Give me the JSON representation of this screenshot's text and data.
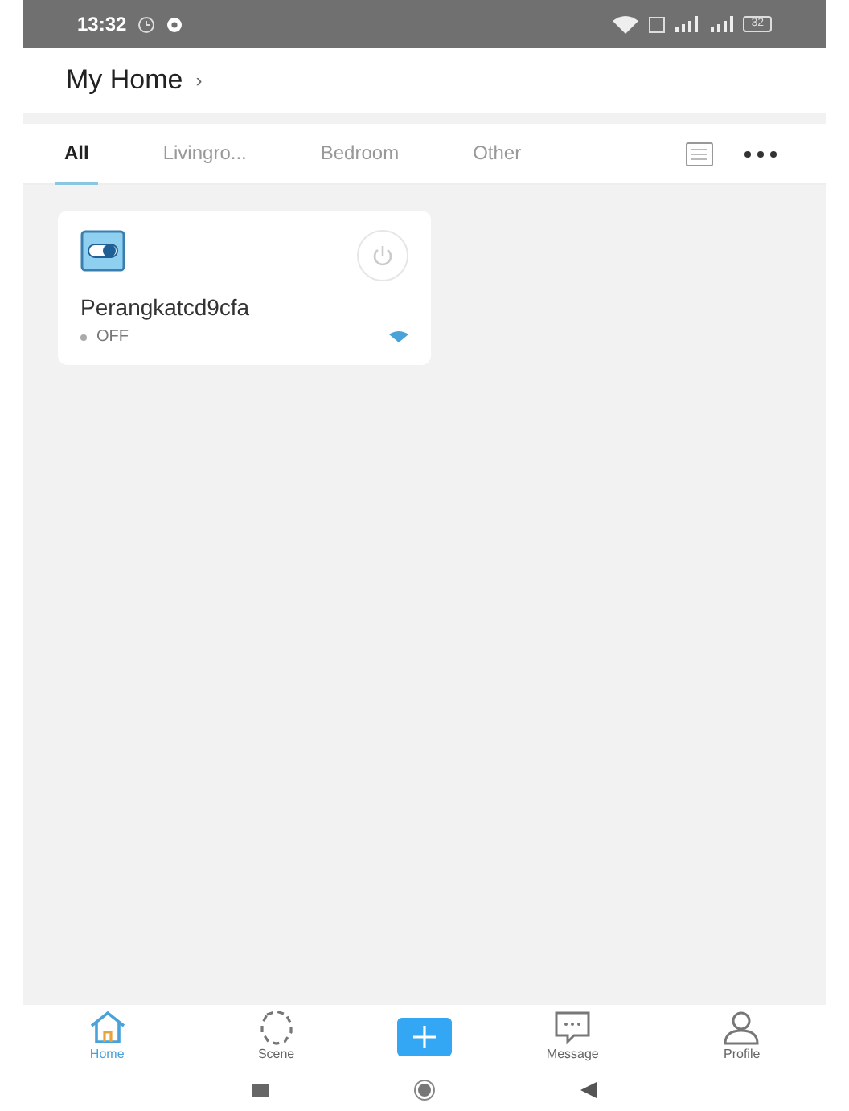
{
  "status_bar": {
    "time": "13:32",
    "battery": "32"
  },
  "header": {
    "title": "My Home",
    "chevron": "›"
  },
  "tabs": [
    {
      "label": "All",
      "selected": true
    },
    {
      "label": "Livingro...",
      "selected": false
    },
    {
      "label": "Bedroom",
      "selected": false
    },
    {
      "label": "Other",
      "selected": false
    }
  ],
  "devices": [
    {
      "name": "Perangkatcd9cfa",
      "status": "OFF",
      "on": false
    }
  ],
  "bottom_nav": [
    {
      "kind": "home",
      "label": "Home",
      "selected": true
    },
    {
      "kind": "scene",
      "label": "Scene",
      "selected": false
    },
    {
      "kind": "add"
    },
    {
      "kind": "message",
      "label": "Message",
      "selected": false
    },
    {
      "kind": "profile",
      "label": "Profile",
      "selected": false
    }
  ]
}
